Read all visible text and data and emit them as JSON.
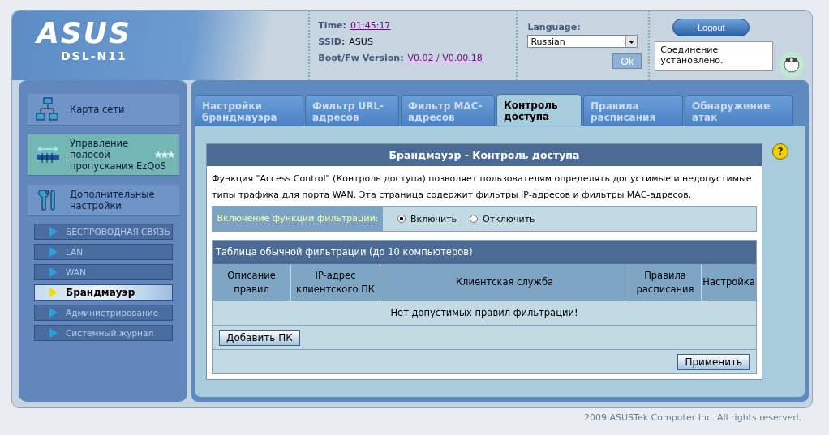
{
  "header": {
    "logo": "ASUS",
    "model": "DSL-N11",
    "time_label": "Time:",
    "time": "01:45:17",
    "ssid_label": "SSID:",
    "ssid": "ASUS",
    "fw_label": "Boot/Fw Version:",
    "fw": "V0.02 / V0.00.18",
    "language_label": "Language:",
    "language": "Russian",
    "ok_button": "Ok",
    "logout_button": "Logout",
    "status": "Соединение установлено."
  },
  "sidebar": {
    "menu": [
      {
        "label": "Карта сети",
        "kind": "network",
        "selected": false
      },
      {
        "label": "Управление полосой пропускания EzQoS",
        "kind": "qos",
        "selected": true
      },
      {
        "label": "Дополнительные настройки",
        "kind": "tools",
        "selected": false
      }
    ],
    "submenu": [
      {
        "label": "БЕСПРОВОДНАЯ СВЯЗЬ",
        "selected": false
      },
      {
        "label": "LAN",
        "selected": false
      },
      {
        "label": "WAN",
        "selected": false
      },
      {
        "label": "Брандмауэр",
        "selected": true
      },
      {
        "label": "Администрирование",
        "selected": false
      },
      {
        "label": "Системный журнал",
        "selected": false
      }
    ]
  },
  "tabs": [
    {
      "label": "Настройки брандмауэра",
      "selected": false
    },
    {
      "label": "Фильтр URL-адресов",
      "selected": false
    },
    {
      "label": "Фильтр MAC-адресов",
      "selected": false
    },
    {
      "label": "Контроль доступа",
      "selected": true
    },
    {
      "label": "Правила расписания",
      "selected": false
    },
    {
      "label": "Обнаружение атак",
      "selected": false
    }
  ],
  "panel": {
    "title": "Брандмауэр - Контроль доступа",
    "description": "Функция \"Access Control\" (Контроль доступа) позволяет пользователям определять допустимые и недопустимые типы трафика для порта WAN. Эта страница содержит фильтры IP-адресов и фильтры MAC-адресов.",
    "help": "?",
    "filter_label": "Включение функции фильтрации:",
    "radios": [
      {
        "label": "Включить",
        "selected": true
      },
      {
        "label": "Отключить",
        "selected": false
      }
    ],
    "table": {
      "title": "Таблица обычной фильтрации (до 10 компьютеров)",
      "columns": [
        "Описание правил",
        "IP-адрес клиентского ПК",
        "Клиентская служба",
        "Правила расписания",
        "Настройка"
      ],
      "empty": "Нет допустимых правил фильтрации!"
    },
    "add_button": "Добавить ПК",
    "apply_button": "Применить"
  },
  "footer": "2009 ASUSTek Computer Inc. All rights reserved."
}
